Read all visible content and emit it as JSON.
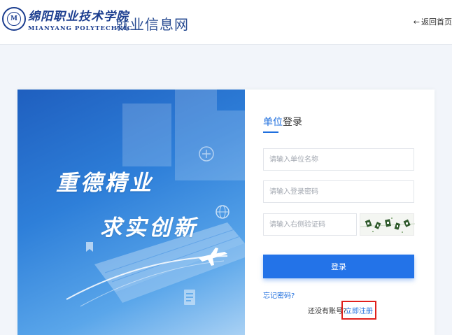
{
  "header": {
    "logo_text_cn": "绵阳职业技术学院",
    "logo_text_en": "MIANYANG  POLYTECHNIC",
    "emblem_letter": "M",
    "site_title": "就业信息网",
    "back_arrow": "←",
    "back_label": "返回首页"
  },
  "banner": {
    "slogan_line1": "重德精业",
    "slogan_line2": "求实创新",
    "icons": [
      "building-icon",
      "bookmark-icon",
      "globe-icon",
      "airplane-icon",
      "document-icon"
    ]
  },
  "login": {
    "title_accent": "单位",
    "title_rest": "登录",
    "company_placeholder": "请输入单位名称",
    "password_placeholder": "请输入登录密码",
    "captcha_placeholder": "请输入右侧验证码",
    "captcha_image": "captcha-image",
    "submit_label": "登录",
    "forgot_label": "忘记密码?",
    "no_account_label": "还没有账号?",
    "register_label": "立即注册"
  },
  "colors": {
    "brand_blue": "#1b3d8f",
    "accent_blue": "#1f6fde",
    "button_blue": "#2373e8",
    "highlight_red": "#e0201c",
    "page_bg": "#f2f5fa"
  }
}
